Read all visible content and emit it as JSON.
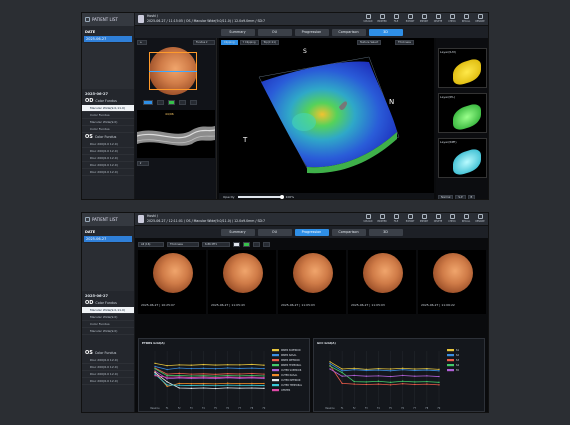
{
  "sidebar": {
    "patient_list": "PATIENT LIST",
    "date_header": "DATE",
    "selected_date": "2025-06-27"
  },
  "window1": {
    "patient_name": "Hoshi /",
    "exam_info": "2025-06-27 / 11:15:05 / OS / Macular Wide(9.0/11.0) / 12.0x9.0mm / SD:7",
    "visit_date": "2025-06-27",
    "od_items": [
      "Color Fundus",
      "Macular Wide(9.0,11.0)",
      "Color Fundus",
      "Macular Wide(9.0)",
      "Color Fundus"
    ],
    "os_items": [
      "Color Fundus",
      "Disc 200(6.0 12.0)",
      "Disc 200(6.0 12.0)",
      "Disc 200(6.0 12.0)",
      "Disc 200(6.0 12.0)",
      "Disc 200(6.0 12.0)"
    ],
    "layer_dropdown": "Fundus",
    "clip1": "Clipping",
    "clip2": "Y Clipping",
    "clip3": "Top(C:11)",
    "texture_select": "Texture Select",
    "thickness_select": "Thickness",
    "zoom_value": "100%",
    "opacity_label": "Opacity",
    "opacity_value": "100%",
    "sidebar_thumbs": [
      "Layer(ILM)",
      "Layer(IPL)",
      "Layer(RPE)"
    ],
    "mini_tabs": [
      "Normal",
      "S-P",
      "B"
    ],
    "bscan_label": "44/96",
    "orient": {
      "s": "S",
      "n": "N",
      "t": "T"
    }
  },
  "window2": {
    "patient_name": "Hoshi /",
    "exam_info": "2025-06-27 / 12:11:01 / OS / Macular Wide(9.0/11.0) / 12.0x9.0mm / SD:7",
    "visit_date": "2025-06-27",
    "od_items": [
      "Color Fundus",
      "Macular Wide(9.0,11.0)",
      "Macular Wide(9.0)",
      "Color Fundus",
      "Macular Wide(9.0)"
    ],
    "os_items": [
      "Color Fundus",
      "Disc 200(6.0 12.0)",
      "Disc 200(6.0 12.0)",
      "Disc 200(6.0 12.0)",
      "Disc 200(6.0 12.0)"
    ],
    "toolbar_select": "All (16)",
    "toolbar_range": "Thickness",
    "toolbar_value": "6.86 MT1",
    "fundus_dates": [
      "2025-06-27 | 10:25:07",
      "2025-06-27 | 11:05:43",
      "2025-06-27 | 11:05:03",
      "2025-06-27 | 11:05:03",
      "2025-06-27 | 11:06:22"
    ],
    "chart1_title": "ETDRS Grid(A)",
    "chart2_title": "GCC Grid(A)"
  },
  "tabs": [
    "Summary",
    "OU",
    "Progression",
    "Comparison",
    "3D"
  ],
  "active_tab_w1": 4,
  "active_tab_w2": 2,
  "toolbar": [
    "UPLOAD",
    "PRINTER",
    "FILE",
    "EXPORT",
    "IMPORT",
    "DELETE",
    "CHECK",
    "RECALL",
    "RENAME",
    "SUBSCRIPTION"
  ],
  "chart_data": [
    {
      "type": "line",
      "title": "ETDRS Grid(A)",
      "categories": [
        "Baseline",
        "F1",
        "F2",
        "F3",
        "F4",
        "F5",
        "F6",
        "F7",
        "F8",
        "F9"
      ],
      "ylim": [
        0,
        350
      ],
      "series": [
        {
          "name": "INNER SUPERIOR",
          "color": "#e6c53d",
          "values": [
            270,
            255,
            260,
            258,
            262,
            259,
            261,
            260,
            263,
            258
          ]
        },
        {
          "name": "INNER NASAL",
          "color": "#3a8de0",
          "values": [
            250,
            230,
            240,
            236,
            238,
            235,
            240,
            237,
            239,
            236
          ]
        },
        {
          "name": "INNER INFERIOR",
          "color": "#ee5d4a",
          "values": [
            240,
            200,
            205,
            200,
            202,
            199,
            203,
            201,
            204,
            200
          ]
        },
        {
          "name": "INNER TEMPORAL",
          "color": "#42c86a",
          "values": [
            235,
            190,
            192,
            188,
            190,
            187,
            191,
            189,
            192,
            188
          ]
        },
        {
          "name": "OUTER SUPERIOR",
          "color": "#b060d8",
          "values": [
            220,
            170,
            175,
            172,
            174,
            171,
            176,
            173,
            175,
            172
          ]
        },
        {
          "name": "OUTER NASAL",
          "color": "#f08a2a",
          "values": [
            215,
            120,
            140,
            138,
            139,
            137,
            141,
            138,
            140,
            139
          ]
        },
        {
          "name": "OUTER INFERIOR",
          "color": "#e2e6ea",
          "values": [
            210,
            150,
            110,
            108,
            110,
            107,
            111,
            109,
            110,
            108
          ]
        },
        {
          "name": "OUTER TEMPORAL",
          "color": "#39c7d6",
          "values": [
            200,
            130,
            128,
            126,
            128,
            125,
            129,
            127,
            128,
            126
          ]
        },
        {
          "name": "CENTER",
          "color": "#e04aa8",
          "values": [
            190,
            180,
            182,
            178,
            181,
            177,
            182,
            179,
            181,
            178
          ]
        }
      ]
    },
    {
      "type": "line",
      "title": "GCC Grid(A)",
      "categories": [
        "Baseline",
        "F1",
        "F2",
        "F3",
        "F4",
        "F5",
        "F6",
        "F7",
        "F8",
        "F9"
      ],
      "ylim": [
        0,
        150
      ],
      "series": [
        {
          "name": "S1",
          "color": "#e6c53d",
          "values": [
            120,
            100,
            102,
            99,
            101,
            100,
            102,
            100,
            101,
            99
          ]
        },
        {
          "name": "S2",
          "color": "#3a8de0",
          "values": [
            115,
            95,
            98,
            96,
            97,
            95,
            98,
            96,
            97,
            95
          ]
        },
        {
          "name": "S3",
          "color": "#ee5d4a",
          "values": [
            110,
            60,
            58,
            57,
            58,
            56,
            59,
            57,
            58,
            56
          ]
        },
        {
          "name": "S4",
          "color": "#42c86a",
          "values": [
            108,
            90,
            65,
            64,
            66,
            63,
            66,
            64,
            65,
            63
          ]
        },
        {
          "name": "S5",
          "color": "#b060d8",
          "values": [
            100,
            80,
            82,
            80,
            81,
            79,
            82,
            80,
            81,
            79
          ]
        }
      ]
    }
  ]
}
